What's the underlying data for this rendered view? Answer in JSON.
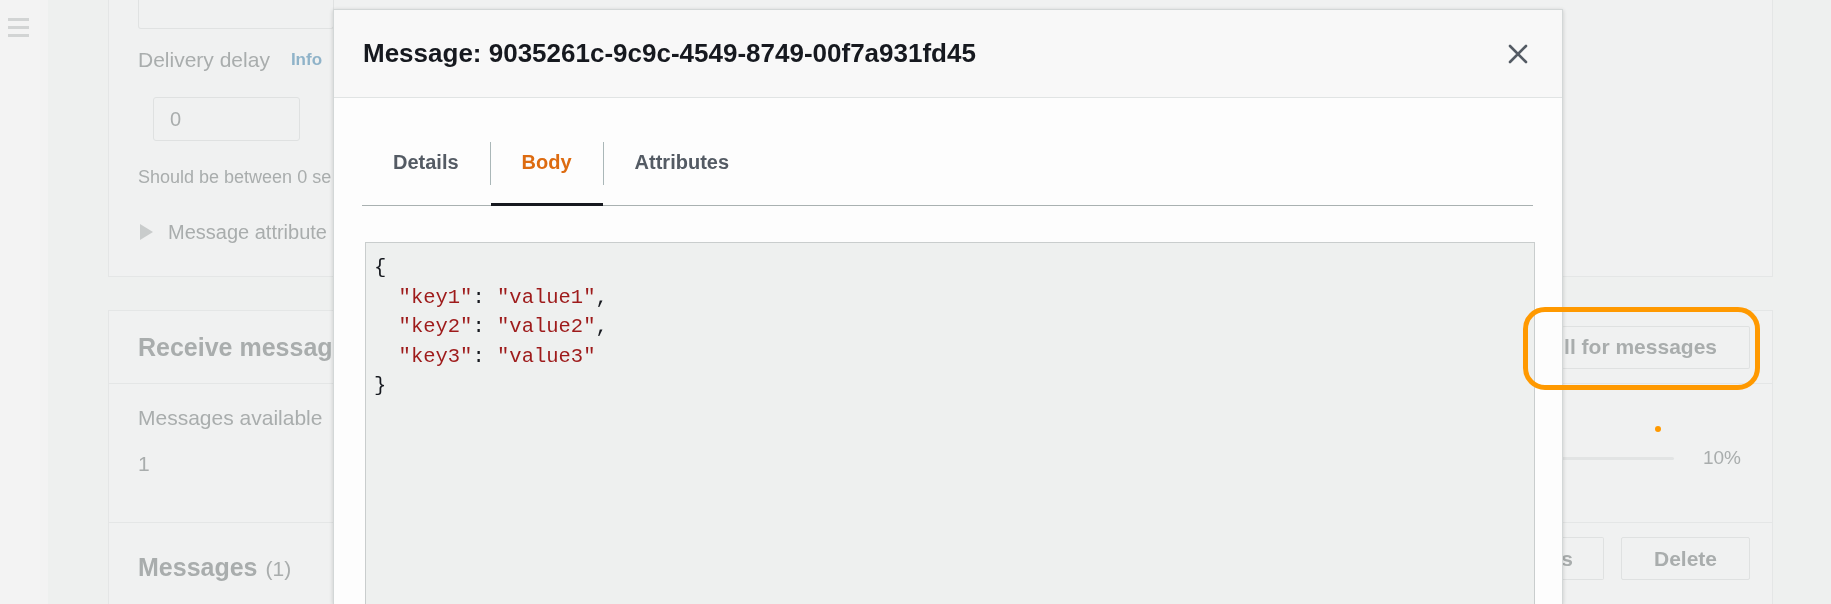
{
  "background": {
    "send_panel": {
      "delay_label": "Delivery delay",
      "info_link": "Info",
      "delay_value": "0",
      "delay_hint": "Should be between 0 se",
      "attributes_toggle": {
        "label": "Message attribute",
        "expanded": false
      }
    },
    "receive_panel": {
      "title": "Receive messag",
      "poll_button": "ll for messages",
      "available_label": "Messages available",
      "available_value": "1",
      "progress_reading": "10%"
    },
    "messages_panel": {
      "title": "Messages",
      "count": "(1)",
      "buttons": [
        "s",
        "Delete"
      ]
    }
  },
  "modal": {
    "title": "Message: 9035261c-9c9c-4549-8749-00f7a931fd45",
    "tabs": [
      {
        "label": "Details",
        "selected": false
      },
      {
        "label": "Body",
        "selected": true
      },
      {
        "label": "Attributes",
        "selected": false
      }
    ],
    "body_lines": [
      "{",
      "  \"key1\": \"value1\",",
      "  \"key2\": \"value2\",",
      "  \"key3\": \"value3\"",
      "}"
    ]
  }
}
